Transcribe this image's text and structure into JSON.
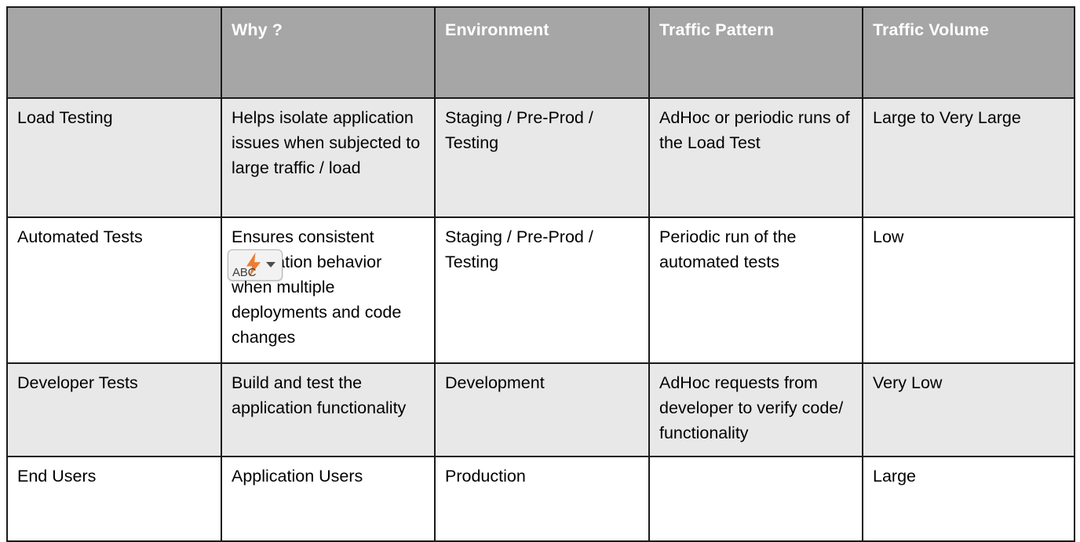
{
  "table": {
    "columns": [
      "",
      "Why ?",
      "Environment",
      "Traffic Pattern",
      "Traffic Volume"
    ],
    "rows": [
      {
        "name": "Load Testing",
        "why": "Helps isolate application issues when subjected to large traffic / load",
        "environment": "Staging / Pre-Prod / Testing",
        "traffic_pattern": "AdHoc or periodic runs of the Load Test",
        "traffic_volume": "Large to Very Large"
      },
      {
        "name": "Automated Tests",
        "why": "Ensures consistent application behavior when multiple deployments and code changes",
        "environment": "Staging / Pre-Prod / Testing",
        "traffic_pattern": "Periodic run of the automated tests",
        "traffic_volume": "Low"
      },
      {
        "name": "Developer Tests",
        "why": "Build and test the application functionality",
        "environment": "Development",
        "traffic_pattern": "AdHoc requests from developer to verify code/ functionality",
        "traffic_volume": "Very Low"
      },
      {
        "name": "End Users",
        "why": "Application Users",
        "environment": "Production",
        "traffic_pattern": "",
        "traffic_volume": "Large"
      }
    ]
  },
  "smart_tag": {
    "label": "ABC",
    "icon": "lightning-bolt-icon",
    "dropdown_icon": "chevron-down-icon",
    "bolt_color": "#ed7d31"
  },
  "colors": {
    "header_fill": "#a6a6a6",
    "header_text": "#ffffff",
    "shade_row_fill": "#e8e8e8",
    "plain_row_fill": "#ffffff",
    "border": "#1a1a1a",
    "body_text": "#000000"
  }
}
